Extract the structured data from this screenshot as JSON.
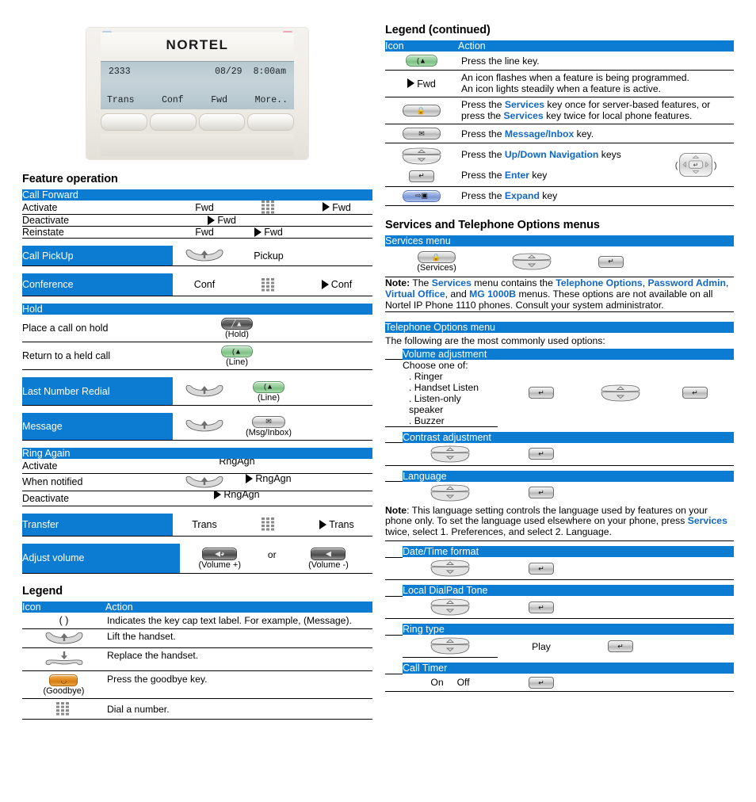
{
  "phone": {
    "brand": "NORTEL",
    "lcd": {
      "line": "2333",
      "date": "08/29",
      "time": "8:00am",
      "softkeys": [
        "Trans",
        "Conf",
        "Fwd",
        "More.."
      ]
    }
  },
  "left": {
    "feature_operation": {
      "title": "Feature operation",
      "groups": [
        {
          "header": "Call Forward",
          "rows": [
            {
              "label": "Activate",
              "c1": "Fwd",
              "c2": "dialpad-icon",
              "c3": "Fwd",
              "c3flash": true
            },
            {
              "label": "Deactivate",
              "c1": "Fwd",
              "c1flash": true
            },
            {
              "label": "Reinstate",
              "c1": "Fwd",
              "c2": "Fwd",
              "c2flash": true
            }
          ]
        },
        {
          "header": "Call PickUp",
          "inline": true,
          "cells": [
            {
              "icon": "handset-lift-icon"
            },
            {
              "text": "Pickup"
            }
          ]
        },
        {
          "header": "Conference",
          "inline": true,
          "cells": [
            {
              "text": "Conf"
            },
            {
              "icon": "dialpad-icon"
            },
            {
              "text": "Conf",
              "flash": true
            }
          ]
        },
        {
          "header": "Hold",
          "rows": [
            {
              "label": "Place a call on hold",
              "key": "hold-key",
              "cap": "(Hold)"
            },
            {
              "label": "Return to a held call",
              "key": "line-key",
              "cap": "(Line)"
            }
          ]
        },
        {
          "header": "Last Number Redial",
          "inline": true,
          "cells": [
            {
              "icon": "handset-lift-icon"
            },
            {
              "key": "line-key",
              "cap": "(Line)"
            }
          ]
        },
        {
          "header": "Message",
          "inline": true,
          "cells": [
            {
              "icon": "handset-lift-icon"
            },
            {
              "key": "msg-inbox-key",
              "cap": "(Msg/Inbox)"
            }
          ]
        },
        {
          "header": "Ring Again",
          "rows": [
            {
              "label": "Activate",
              "c1": "RngAgn",
              "clip": true
            },
            {
              "label": "When notified",
              "icon": "handset-lift-icon",
              "c2": "RngAgn",
              "c2flash": true,
              "clip": true
            },
            {
              "label": "Deactivate",
              "c1": "RngAgn",
              "c1flash": true,
              "clip": true
            }
          ]
        },
        {
          "header": "Transfer",
          "inline": true,
          "cells": [
            {
              "text": "Trans"
            },
            {
              "icon": "dialpad-icon"
            },
            {
              "text": "Trans",
              "flash": true
            }
          ]
        },
        {
          "header": "Adjust volume",
          "inline": true,
          "cells": [
            {
              "key": "volume-up-key",
              "cap": "(Volume +)"
            },
            {
              "text": "or"
            },
            {
              "key": "volume-down-key",
              "cap": "(Volume -)"
            }
          ]
        }
      ]
    },
    "legend": {
      "title": "Legend",
      "col_icon": "Icon",
      "col_action": "Action",
      "rows": [
        {
          "icon": "parens-icon",
          "icon_text": "(  )",
          "action": "Indicates the key cap text label. For example, (Message)."
        },
        {
          "icon": "handset-lift-icon",
          "action": "Lift the handset."
        },
        {
          "icon": "handset-replace-icon",
          "action": "Replace the handset."
        },
        {
          "icon": "goodbye-key",
          "cap": "(Goodbye)",
          "action": "Press the goodbye key."
        },
        {
          "icon": "dialpad-icon",
          "action": "Dial a number."
        }
      ]
    }
  },
  "right": {
    "legend_continued": {
      "title": "Legend (continued)",
      "col_icon": "Icon",
      "col_action": "Action",
      "rows": [
        {
          "icon": "line-key",
          "action": "Press the line key."
        },
        {
          "icon": "flash-fwd-icon",
          "icon_text": "Fwd",
          "action_lines": [
            "An icon flashes when a feature is being programmed.",
            "An icon lights steadily when a feature is active."
          ]
        },
        {
          "icon": "services-key",
          "action_rich": [
            {
              "t": "Press the "
            },
            {
              "t": "Services",
              "blue": true
            },
            {
              "t": " key once for server-based features, or press the "
            },
            {
              "t": "Services",
              "blue": true
            },
            {
              "t": " key twice for local phone features."
            }
          ]
        },
        {
          "icon": "msg-inbox-key",
          "action_rich": [
            {
              "t": "Press the "
            },
            {
              "t": "Message/Inbox",
              "blue": true
            },
            {
              "t": " key."
            }
          ]
        },
        {
          "icon": "nav-updown-key",
          "icon2": "enter-key",
          "action_rich": [
            {
              "t": "Press the "
            },
            {
              "t": "Up/Down Navigation",
              "blue": true
            },
            {
              "t": " keys"
            }
          ],
          "action_rich2": [
            {
              "t": "Press the "
            },
            {
              "t": "Enter",
              "blue": true
            },
            {
              "t": " key"
            }
          ],
          "extra_icon": "nav-cluster-icon"
        },
        {
          "icon": "expand-key",
          "action_rich": [
            {
              "t": "Press the "
            },
            {
              "t": "Expand",
              "blue": true
            },
            {
              "t": " key"
            }
          ]
        }
      ]
    },
    "services": {
      "title": "Services and Telephone Options menus",
      "menu_header": "Services menu",
      "keys": [
        {
          "key": "services-key",
          "cap": "(Services)"
        },
        {
          "key": "nav-updown-key"
        },
        {
          "key": "enter-key"
        }
      ],
      "note": [
        {
          "t": "Note:",
          "bold": true
        },
        {
          "t": " The "
        },
        {
          "t": "Services",
          "blue": true
        },
        {
          "t": " menu contains the "
        },
        {
          "t": "Telephone Options",
          "blue": true
        },
        {
          "t": ", "
        },
        {
          "t": "Password Admin",
          "blue": true
        },
        {
          "t": ", "
        },
        {
          "t": "Virtual Office",
          "blue": true
        },
        {
          "t": ", and "
        },
        {
          "t": "MG 1000B",
          "blue": true
        },
        {
          "t": " menus. These options are not available on all Nortel IP Phone 1110 phones. Consult your system administrator."
        }
      ]
    },
    "telephone_options": {
      "header": "Telephone Options menu",
      "intro": "The following are the most commonly used options:",
      "sections": [
        {
          "header": "Volume adjustment",
          "choose_label": "Choose one of:",
          "options": [
            ". Ringer",
            ". Handset Listen",
            ". Listen-only",
            "  speaker",
            ". Buzzer"
          ],
          "keys": [
            "enter-key",
            "nav-updown-key",
            "enter-key"
          ]
        },
        {
          "header": "Contrast adjustment",
          "keys": [
            "nav-updown-key",
            "enter-key"
          ]
        },
        {
          "header": "Language",
          "keys": [
            "nav-updown-key",
            "enter-key"
          ],
          "note": [
            {
              "t": "Note",
              "bold": true
            },
            {
              "t": ": This language setting controls the language used by features on your phone only. To set the language used elsewhere on your phone, press "
            },
            {
              "t": "Services",
              "blue": true
            },
            {
              "t": " twice, select 1. Preferences, and select 2. Language."
            }
          ]
        },
        {
          "header": "Date/Time format",
          "keys": [
            "nav-updown-key",
            "enter-key"
          ]
        },
        {
          "header": "Local DialPad Tone",
          "keys": [
            "nav-updown-key",
            "enter-key"
          ]
        },
        {
          "header": "Ring type",
          "keys": [
            "nav-updown-key"
          ],
          "mid_text": "Play",
          "keys_after": [
            "enter-key"
          ]
        },
        {
          "header": "Call Timer",
          "texts": [
            "On",
            "Off"
          ],
          "keys_after": [
            "enter-key"
          ]
        }
      ]
    }
  },
  "colors": {
    "header_blue": "#0b7cd1",
    "link_blue": "#1268c4",
    "line_green": "#8fcc95",
    "goodbye_orange": "#e08a1e",
    "expand_blue": "#8fa6dd"
  }
}
